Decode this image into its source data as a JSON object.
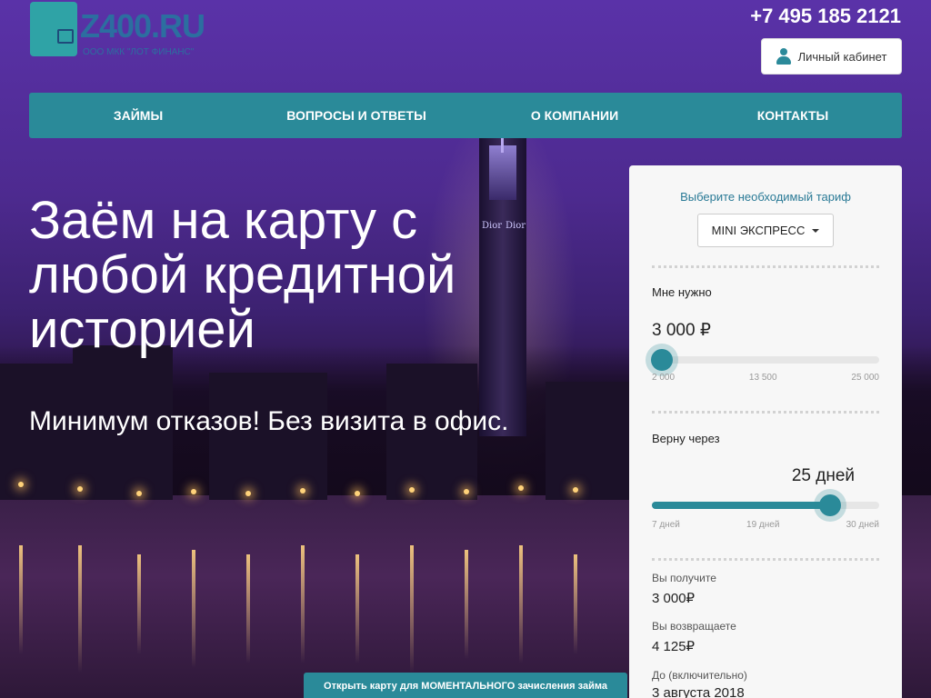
{
  "header": {
    "logo_name": "Z400.RU",
    "logo_subtitle": "ООО МКК \"ЛОТ ФИНАНС\"",
    "phone": "+7 495 185 2121",
    "cabinet_label": "Личный кабинет"
  },
  "nav": {
    "items": [
      {
        "label": "ЗАЙМЫ"
      },
      {
        "label": "ВОПРОСЫ И ОТВЕТЫ"
      },
      {
        "label": "О КОМПАНИИ"
      },
      {
        "label": "КОНТАКТЫ"
      }
    ]
  },
  "hero": {
    "title": "Заём на карту с\nлюбой кредитной\nисторией",
    "subtitle": "Минимум отказов! Без визита в офис."
  },
  "promo": {
    "text": "Открыть карту для МОМЕНТАЛЬНОГО зачисления займа"
  },
  "calculator": {
    "caption": "Выберите необходимый тариф",
    "tariff": "MINI ЭКСПРЕСС",
    "amount_label": "Мне нужно",
    "amount_value": "3 000 ₽",
    "amount_slider": {
      "min": 2000,
      "max": 25000,
      "value": 3000,
      "ticks": [
        "2 000",
        "13 500",
        "25 000"
      ]
    },
    "term_label": "Верну через",
    "term_value": "25 дней",
    "term_slider": {
      "min": 7,
      "max": 30,
      "value": 25,
      "ticks": [
        "7 дней",
        "19 дней",
        "30 дней"
      ]
    },
    "receive_label": "Вы получите",
    "receive_value": "3 000₽",
    "return_label": "Вы возвращаете",
    "return_value": "4 125₽",
    "until_label": "До (включительно)",
    "until_value": "3 августа 2018"
  },
  "colors": {
    "accent": "#2a8a99",
    "logo": "#2c6ea0"
  }
}
